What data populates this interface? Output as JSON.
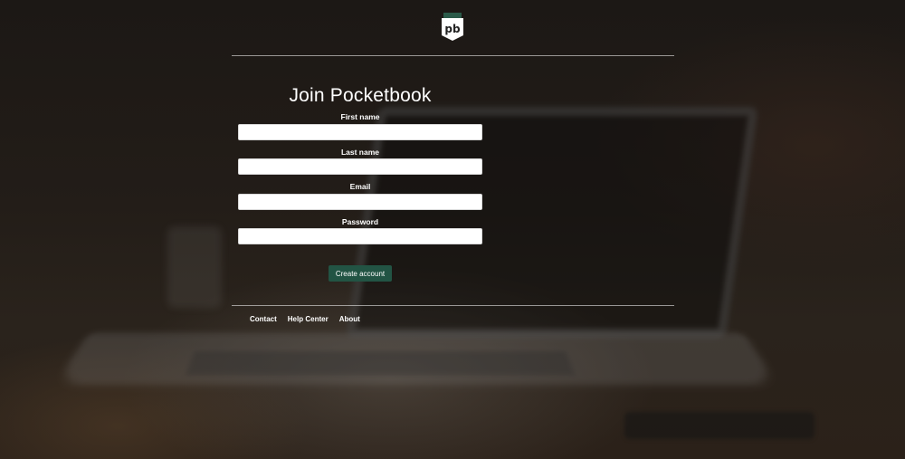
{
  "brand": {
    "logo_text": "pb",
    "logo_color": "#2b5a49"
  },
  "form": {
    "title": "Join Pocketbook",
    "fields": [
      {
        "label": "First name",
        "value": ""
      },
      {
        "label": "Last name",
        "value": ""
      },
      {
        "label": "Email",
        "value": ""
      },
      {
        "label": "Password",
        "value": ""
      }
    ],
    "submit_label": "Create account",
    "submit_color": "#225444"
  },
  "footer": {
    "links": [
      "Contact",
      "Help Center",
      "About"
    ]
  }
}
